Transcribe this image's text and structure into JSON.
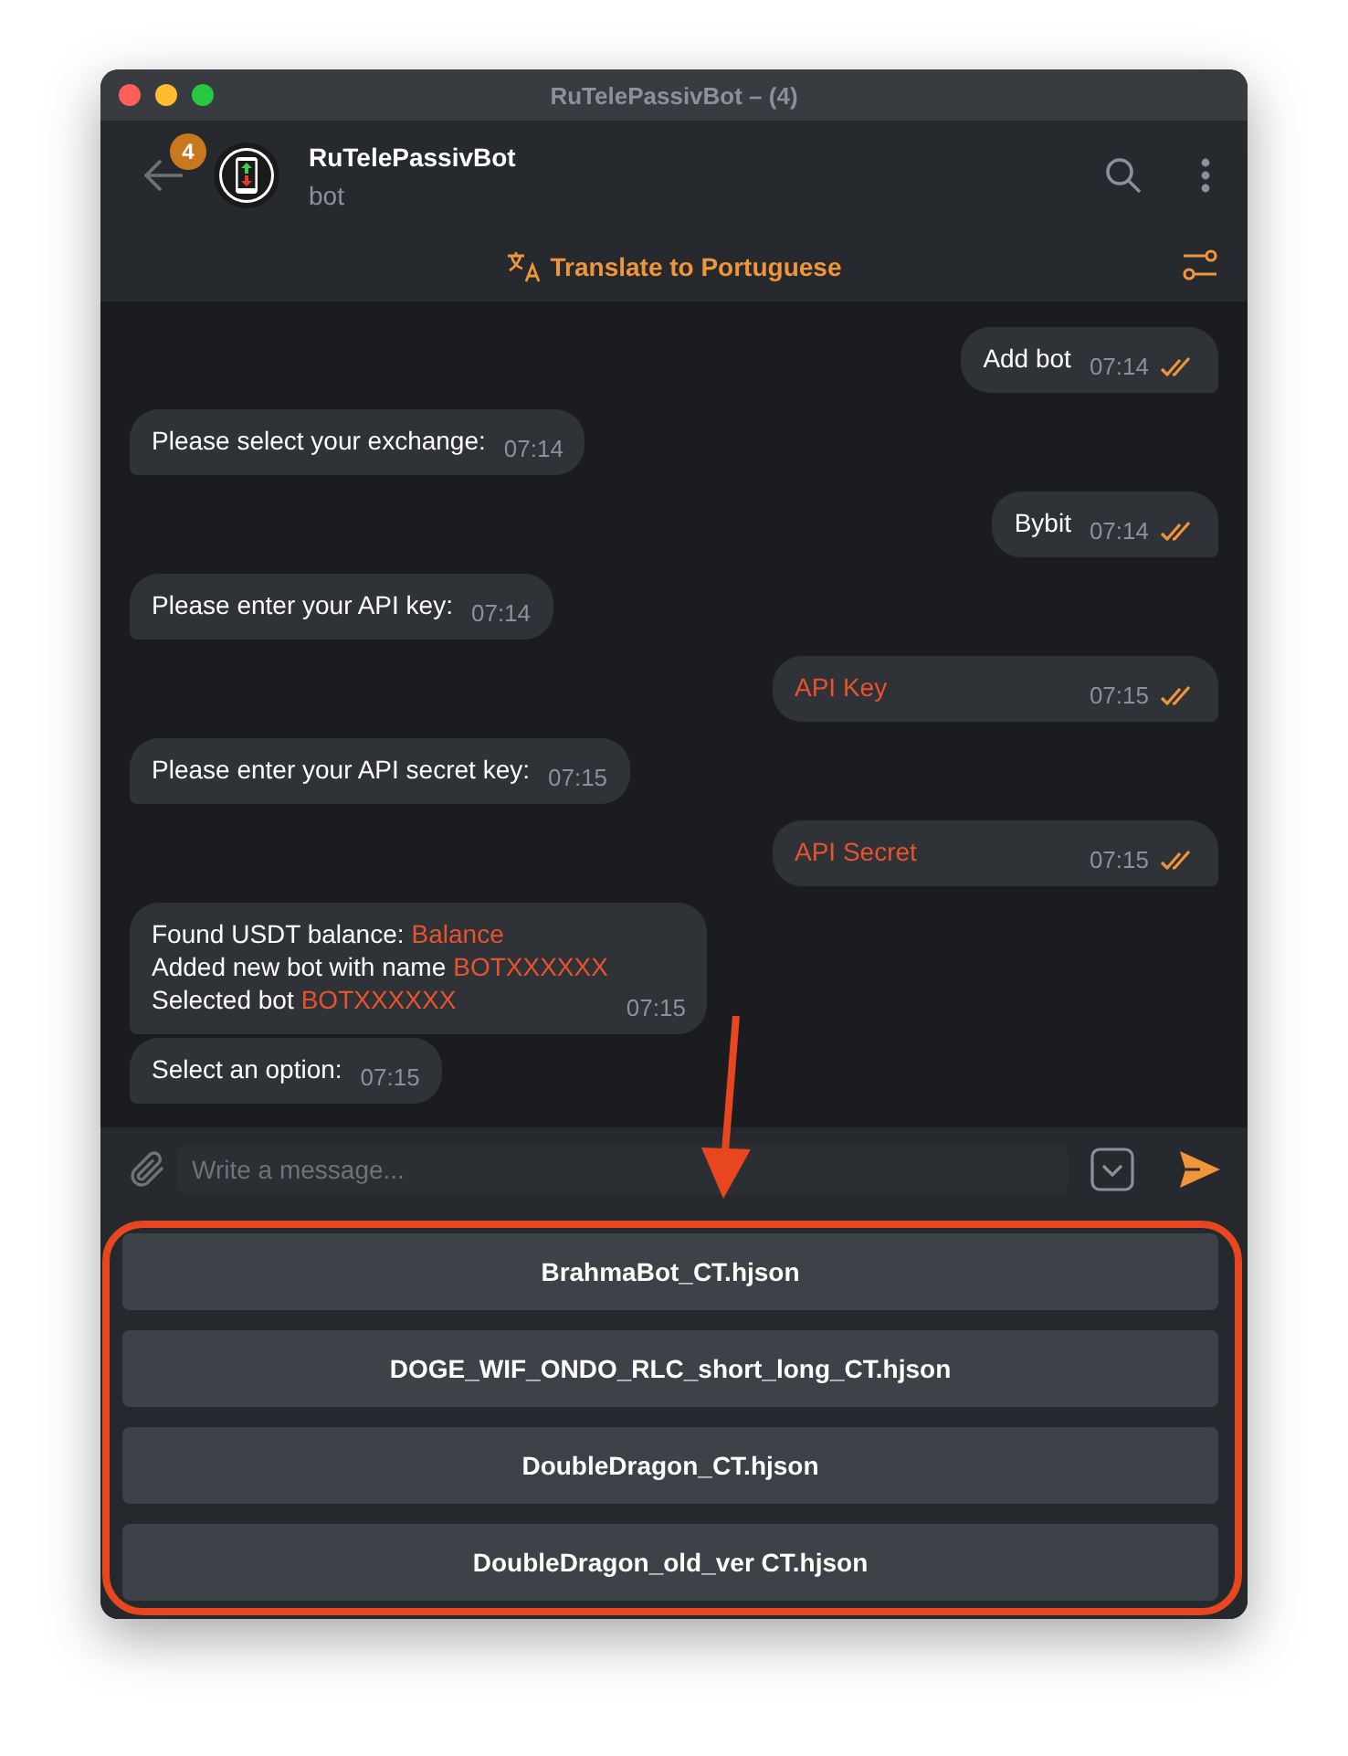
{
  "window": {
    "title": "RuTelePassivBot – (4)"
  },
  "header": {
    "unread_badge": "4",
    "name": "RuTelePassivBot",
    "status": "bot"
  },
  "translate_bar": {
    "label": "Translate to Portuguese"
  },
  "messages": [
    {
      "kind": "out",
      "lines": [
        {
          "text": "Add bot"
        }
      ],
      "time": "07:14",
      "read": true
    },
    {
      "kind": "in",
      "lines": [
        {
          "text": "Please select your exchange:"
        }
      ],
      "time": "07:14"
    },
    {
      "kind": "out",
      "lines": [
        {
          "text": "Bybit"
        }
      ],
      "time": "07:14",
      "read": true
    },
    {
      "kind": "in",
      "lines": [
        {
          "text": "Please enter your API key:"
        }
      ],
      "time": "07:14"
    },
    {
      "kind": "out",
      "lines": [
        {
          "highlight": "API Key"
        }
      ],
      "time": "07:15",
      "read": true
    },
    {
      "kind": "in",
      "lines": [
        {
          "text": "Please enter your API secret key:"
        }
      ],
      "time": "07:15"
    },
    {
      "kind": "out",
      "lines": [
        {
          "highlight": "API Secret"
        }
      ],
      "time": "07:15",
      "read": true
    },
    {
      "kind": "in",
      "lines": [
        {
          "text": "Found USDT balance:",
          "highlight": "Balance"
        },
        {
          "text": "Added new bot with name",
          "highlight": "BOTXXXXXX"
        },
        {
          "text": "Selected bot",
          "highlight": "BOTXXXXXX"
        }
      ],
      "time": "07:15"
    },
    {
      "kind": "in",
      "lines": [
        {
          "text": "Select an option:"
        }
      ],
      "time": "07:15"
    }
  ],
  "composer": {
    "placeholder": "Write a message..."
  },
  "keyboard": [
    "BrahmaBot_CT.hjson",
    "DOGE_WIF_ONDO_RLC_short_long_CT.hjson",
    "DoubleDragon_CT.hjson",
    "DoubleDragon_old_ver CT.hjson"
  ]
}
